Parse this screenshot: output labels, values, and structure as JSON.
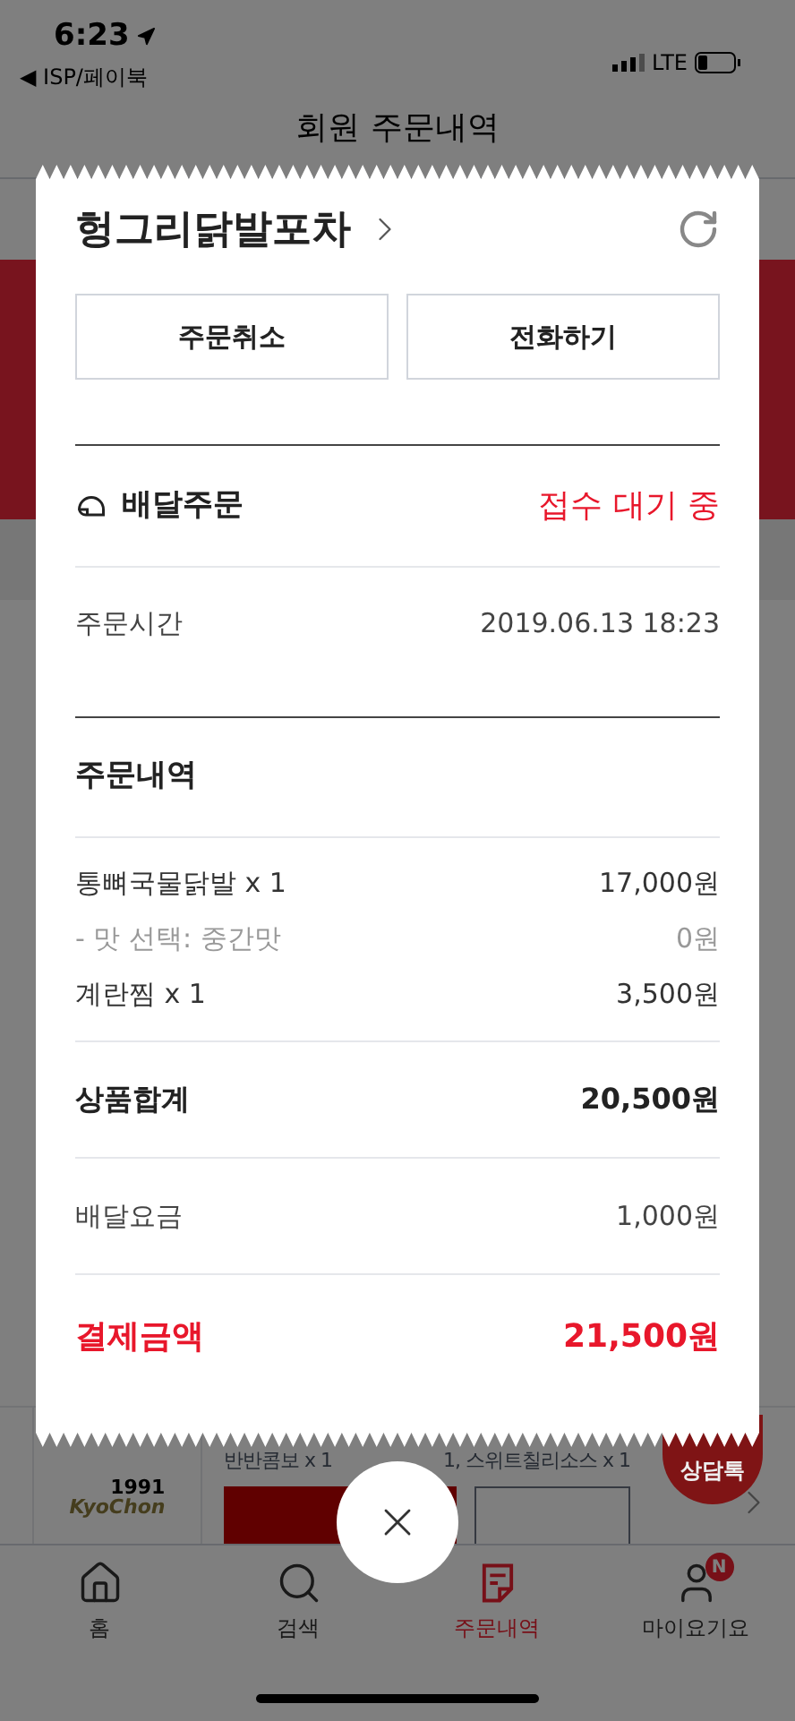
{
  "status_bar": {
    "time": "6:23",
    "back_app": "◀ ISP/페이북",
    "network": "LTE"
  },
  "header": {
    "title": "회원 주문내역"
  },
  "background_order": {
    "logo_text": "KyoChon",
    "logo_year": "1991",
    "menu_parts": [
      "반반콤보 x 1",
      "1, 스위트칠리소스 x 1"
    ],
    "chat_badge": "상담톡"
  },
  "tab_bar": [
    {
      "label": "홈",
      "selected": false
    },
    {
      "label": "검색",
      "selected": false
    },
    {
      "label": "주문내역",
      "selected": true
    },
    {
      "label": "마이요기요",
      "selected": false,
      "badge": "N"
    }
  ],
  "modal": {
    "store_name": "헝그리닭발포차",
    "buttons": [
      "주문취소",
      "전화하기"
    ],
    "order_type": "배달주문",
    "order_status": "접수 대기 중",
    "order_time_label": "주문시간",
    "order_time": "2019.06.13 18:23",
    "items_title": "주문내역",
    "items": [
      {
        "kind": "item",
        "name": "통뼈국물닭발 x 1",
        "price": "17,000원"
      },
      {
        "kind": "option",
        "name": "- 맛 선택: 중간맛",
        "price": "0원"
      },
      {
        "kind": "item",
        "name": "계란찜 x 1",
        "price": "3,500원"
      }
    ],
    "subtotal_label": "상품합계",
    "subtotal": "20,500원",
    "delivery_fee_label": "배달요금",
    "delivery_fee": "1,000원",
    "total_label": "결제금액",
    "total": "21,500원"
  }
}
